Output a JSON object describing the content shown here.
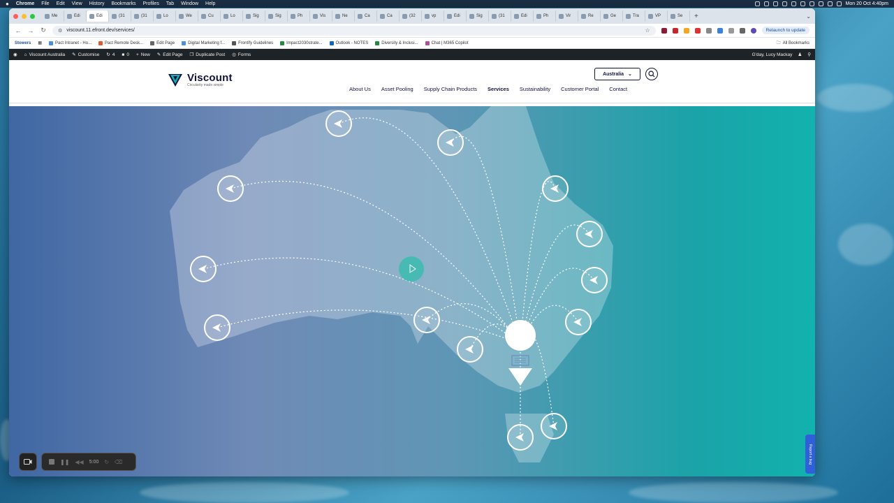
{
  "menubar": {
    "apple": "",
    "app": "Chrome",
    "items": [
      "File",
      "Edit",
      "View",
      "History",
      "Bookmarks",
      "Profiles",
      "Tab",
      "Window",
      "Help"
    ],
    "clock": "Mon 20 Oct 4:40pm"
  },
  "tabs": [
    "Me",
    "Edi",
    "Edi",
    "(31",
    "(31",
    "Lo",
    "We",
    "Cu",
    "Lo",
    "Sig",
    "Sig",
    "Ph",
    "Vis",
    "Ne",
    "Ca",
    "Ca",
    "(32",
    "vp",
    "Edi",
    "Sig",
    "(31",
    "Edi",
    "Ph",
    "Vir",
    "Re",
    "Ge",
    "Tra",
    "VP",
    "Se"
  ],
  "toolbar": {
    "url": "viscount.11.efront.dev/services/",
    "relaunch": "Relaunch to update"
  },
  "bookmarks": {
    "first": "Stowers",
    "items": [
      "Pact Intranet - Ho...",
      "Pact Remote Desk...",
      "Edit Page",
      "Digital Marketing f...",
      "Frontify Guidelines",
      "Impact2030strate...",
      "Outlook - NOTES",
      "Diversity & Inclusi...",
      "Chat | M365 Copilot"
    ],
    "all": "All Bookmarks"
  },
  "wpbar": {
    "site": "Viscount Australia",
    "customise": "Customise",
    "updates": "4",
    "comments": "0",
    "new": "New",
    "edit": "Edit Page",
    "duplicate": "Duplicate Post",
    "forms": "Forms",
    "greeting": "G'day, Lucy Mackay"
  },
  "site": {
    "logo_name": "Viscount",
    "logo_tag": "Circularity made simple",
    "region": "Australia",
    "nav": [
      "About Us",
      "Asset Pooling",
      "Supply Chain Products",
      "Services",
      "Sustainability",
      "Customer Portal",
      "Contact"
    ],
    "active_nav": "Services"
  },
  "feedback": "Report a bug",
  "recorder": {
    "time": "5:00"
  },
  "colors": {
    "navy": "#10123f",
    "teal": "#12b2ae",
    "accent_blue": "#2f5fd9"
  }
}
